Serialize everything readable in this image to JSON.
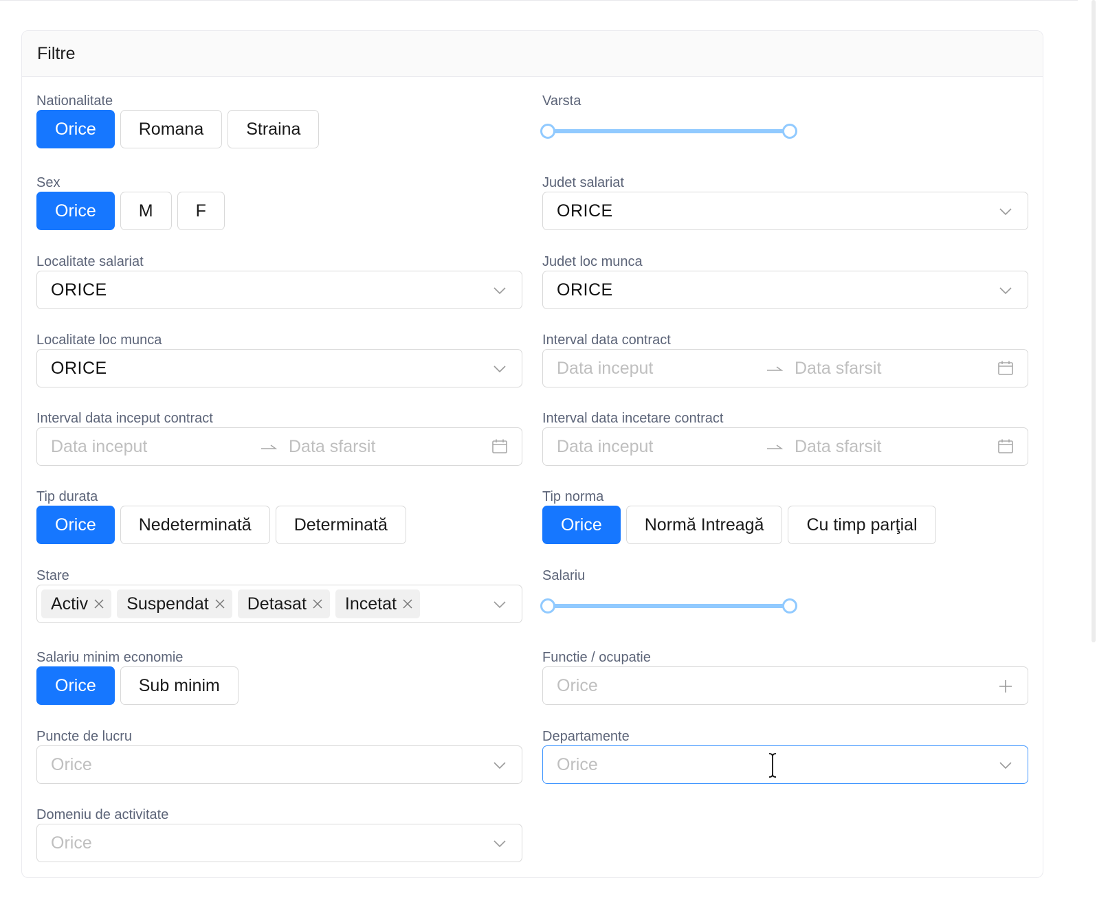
{
  "card": {
    "title": "Filtre"
  },
  "nationalitate": {
    "label": "Nationalitate",
    "options": [
      "Orice",
      "Romana",
      "Straina"
    ],
    "selected": "Orice"
  },
  "varsta": {
    "label": "Varsta",
    "range": [
      0,
      1
    ]
  },
  "sex": {
    "label": "Sex",
    "options": [
      "Orice",
      "M",
      "F"
    ],
    "selected": "Orice"
  },
  "judet_salariat": {
    "label": "Judet salariat",
    "value": "ORICE"
  },
  "localitate_salariat": {
    "label": "Localitate salariat",
    "value": "ORICE"
  },
  "judet_loc_munca": {
    "label": "Judet loc munca",
    "value": "ORICE"
  },
  "localitate_loc_munca": {
    "label": "Localitate loc munca",
    "value": "ORICE"
  },
  "interval_data_contract": {
    "label": "Interval data contract",
    "start_placeholder": "Data inceput",
    "end_placeholder": "Data sfarsit"
  },
  "interval_data_inceput_contract": {
    "label": "Interval data inceput contract",
    "start_placeholder": "Data inceput",
    "end_placeholder": "Data sfarsit"
  },
  "interval_data_incetare_contract": {
    "label": "Interval data incetare contract",
    "start_placeholder": "Data inceput",
    "end_placeholder": "Data sfarsit"
  },
  "tip_durata": {
    "label": "Tip durata",
    "options": [
      "Orice",
      "Nedeterminată",
      "Determinată"
    ],
    "selected": "Orice"
  },
  "tip_norma": {
    "label": "Tip norma",
    "options": [
      "Orice",
      "Normă Intreagă",
      "Cu timp parţial"
    ],
    "selected": "Orice"
  },
  "stare": {
    "label": "Stare",
    "tags": [
      "Activ",
      "Suspendat",
      "Detasat",
      "Incetat"
    ]
  },
  "salariu": {
    "label": "Salariu",
    "range": [
      0,
      1
    ]
  },
  "salariu_minim_economie": {
    "label": "Salariu minim economie",
    "options": [
      "Orice",
      "Sub minim"
    ],
    "selected": "Orice"
  },
  "functie_ocupatie": {
    "label": "Functie / ocupatie",
    "placeholder": "Orice"
  },
  "puncte_de_lucru": {
    "label": "Puncte de lucru",
    "placeholder": "Orice"
  },
  "departamente": {
    "label": "Departamente",
    "placeholder": "Orice"
  },
  "domeniu_de_activitate": {
    "label": "Domeniu de activitate",
    "placeholder": "Orice"
  },
  "icons": {
    "dropdown": "chevron-down-icon",
    "calendar": "calendar-icon",
    "range_separator": "arrow-right-icon",
    "tag_remove": "close-icon",
    "add": "plus-icon",
    "cursor": "text-cursor-icon"
  },
  "colors": {
    "primary": "#1677ff",
    "slider": "#91caff",
    "border": "#d9d9d9",
    "label": "#5c6478",
    "placeholder": "#bfbfbf"
  }
}
